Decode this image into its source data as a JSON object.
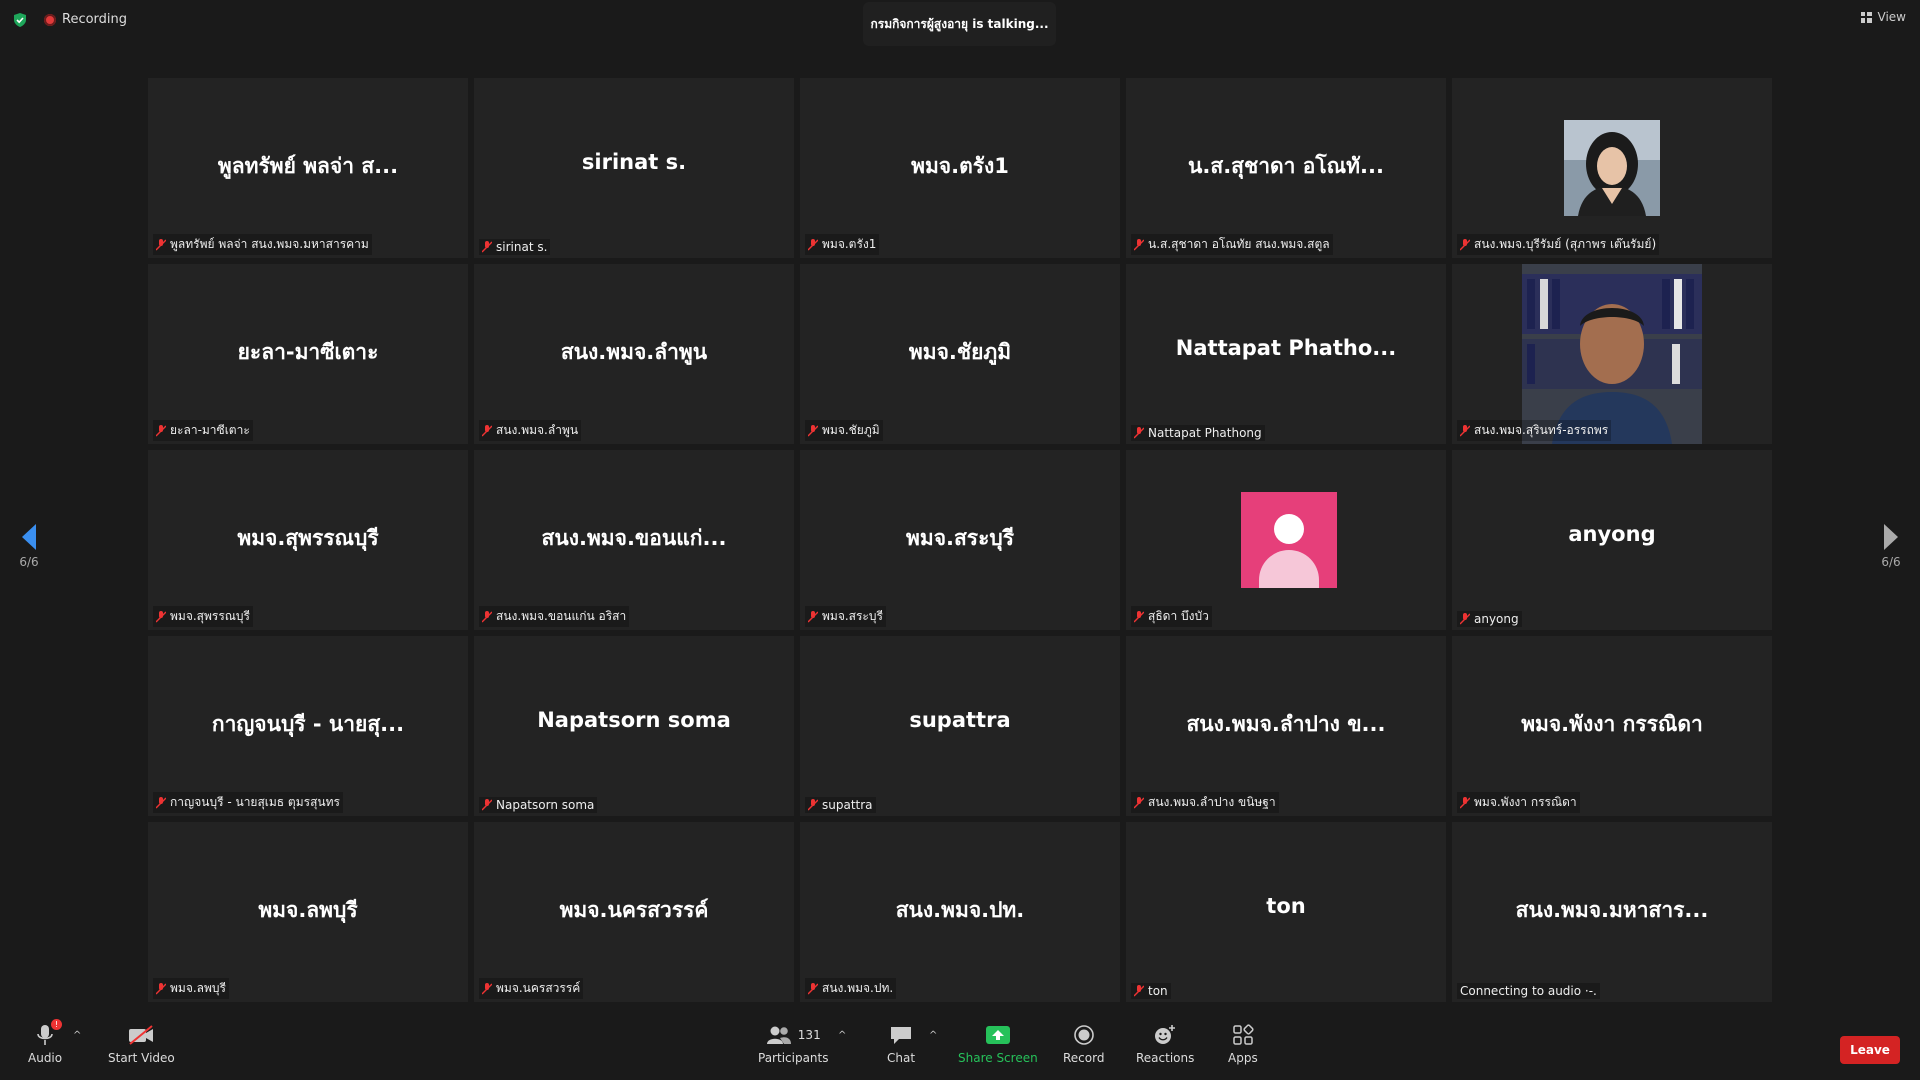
{
  "top": {
    "recording_label": "Recording",
    "talking": "กรมกิจการผู้สูงอายุ is  talking...",
    "view_label": "View"
  },
  "nav": {
    "left_page": "6/6",
    "right_page": "6/6"
  },
  "tiles": [
    {
      "name": "พูลทรัพย์ พลจ่า ส...",
      "label": "พูลทรัพย์ พลจ่า สนง.พมจ.มหาสารคาม"
    },
    {
      "name": "sirinat s.",
      "label": "sirinat s."
    },
    {
      "name": "พมจ.ตรัง1",
      "label": "พมจ.ตรัง1"
    },
    {
      "name": "น.ส.สุชาดา อโณทั...",
      "label": "น.ส.สุชาดา อโณทัย สนง.พมจ.สตูล"
    },
    {
      "name": "",
      "label": "สนง.พมจ.บุรีรัมย์ (สุภาพร เต๊นรัมย์)"
    },
    {
      "name": "ยะลา-มาซีเตาะ",
      "label": "ยะลา-มาซีเตาะ"
    },
    {
      "name": "สนง.พมจ.ลำพูน",
      "label": "สนง.พมจ.ลำพูน"
    },
    {
      "name": "พมจ.ชัยภูมิ",
      "label": "พมจ.ชัยภูมิ"
    },
    {
      "name": "Nattapat Phatho...",
      "label": "Nattapat Phathong"
    },
    {
      "name": "",
      "label": "สนง.พมจ.สุรินทร์-อรรถพร"
    },
    {
      "name": "พมจ.สุพรรณบุรี",
      "label": "พมจ.สุพรรณบุรี"
    },
    {
      "name": "สนง.พมจ.ขอนแก่...",
      "label": "สนง.พมจ.ขอนแก่น อริสา"
    },
    {
      "name": "พมจ.สระบุรี",
      "label": "พมจ.สระบุรี"
    },
    {
      "name": "",
      "label": "สุธิดา บึงบัว"
    },
    {
      "name": "anyong",
      "label": "anyong"
    },
    {
      "name": "กาญจนบุรี - นายสุ...",
      "label": "กาญจนบุรี - นายสุเมธ ตุมรสุนทร"
    },
    {
      "name": "Napatsorn soma",
      "label": "Napatsorn soma"
    },
    {
      "name": "supattra",
      "label": "supattra"
    },
    {
      "name": "สนง.พมจ.ลำปาง ข...",
      "label": "สนง.พมจ.ลำปาง ขนิษฐา"
    },
    {
      "name": "พมจ.พังงา กรรณิดา",
      "label": "พมจ.พังงา กรรณิดา"
    },
    {
      "name": "พมจ.ลพบุรี",
      "label": "พมจ.ลพบุรี"
    },
    {
      "name": "พมจ.นครสวรรค์",
      "label": "พมจ.นครสวรรค์"
    },
    {
      "name": "สนง.พมจ.ปท.",
      "label": "สนง.พมจ.ปท."
    },
    {
      "name": "ton",
      "label": "ton"
    },
    {
      "name": "สนง.พมจ.มหาสาร...",
      "label": "Connecting to audio ·-."
    }
  ],
  "toolbar": {
    "audio": "Audio",
    "start_video": "Start Video",
    "participants": "Participants",
    "participants_count": "131",
    "chat": "Chat",
    "share_screen": "Share Screen",
    "record": "Record",
    "reactions": "Reactions",
    "apps": "Apps",
    "leave": "Leave",
    "audio_badge": "!"
  },
  "colors": {
    "leave": "#d42323",
    "share": "#26c15a",
    "avatar": "#e63f7a",
    "muted": "#e33"
  }
}
